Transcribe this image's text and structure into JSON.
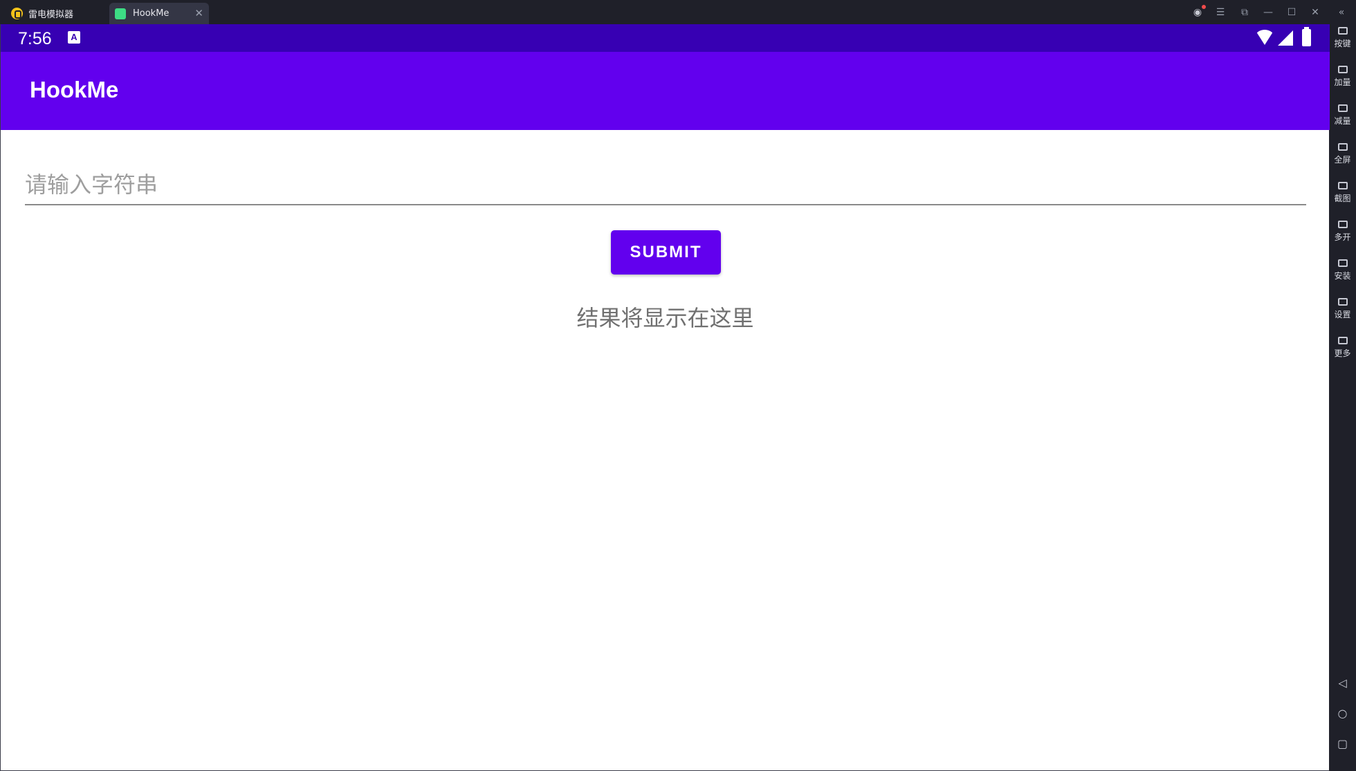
{
  "window": {
    "tabs": [
      {
        "label": "雷电模拟器"
      },
      {
        "label": "HookMe"
      }
    ]
  },
  "sidebar": {
    "items": [
      {
        "label": "按键",
        "icon": "keyboard-icon"
      },
      {
        "label": "加量",
        "icon": "volume-up-icon"
      },
      {
        "label": "减量",
        "icon": "volume-down-icon"
      },
      {
        "label": "全屏",
        "icon": "fullscreen-icon"
      },
      {
        "label": "截图",
        "icon": "screenshot-icon"
      },
      {
        "label": "多开",
        "icon": "multi-instance-icon"
      },
      {
        "label": "安装",
        "icon": "install-icon"
      },
      {
        "label": "设置",
        "icon": "settings-icon"
      },
      {
        "label": "更多",
        "icon": "more-icon"
      }
    ]
  },
  "statusbar": {
    "time": "7:56",
    "notification_icon": "A"
  },
  "appbar": {
    "title": "HookMe"
  },
  "form": {
    "input_placeholder": "请输入字符串",
    "input_value": "",
    "submit_label": "SUBMIT",
    "result_text": "结果将显示在这里"
  },
  "colors": {
    "status_bar": "#3700b3",
    "primary": "#6200ee"
  }
}
